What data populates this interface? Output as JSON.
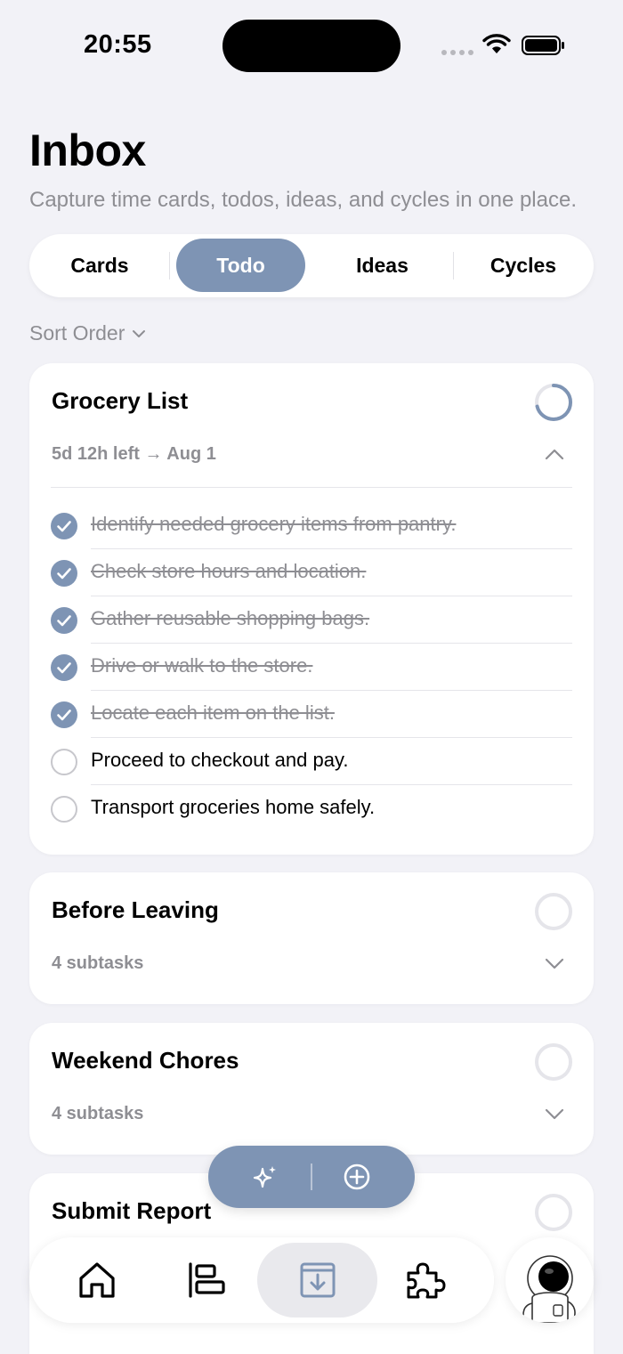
{
  "status": {
    "time": "20:55"
  },
  "header": {
    "title": "Inbox",
    "subtitle": "Capture time cards, todos, ideas, and cycles in one place."
  },
  "tabs": [
    {
      "label": "Cards"
    },
    {
      "label": "Todo",
      "active": true
    },
    {
      "label": "Ideas"
    },
    {
      "label": "Cycles"
    }
  ],
  "sort_label": "Sort Order",
  "accent_color": "#7e94b4",
  "cards": [
    {
      "title": "Grocery List",
      "meta": "5d 12h left → Aug 1",
      "progress": 0.71,
      "expanded": true,
      "items": [
        {
          "text": "Identify needed grocery items from pantry.",
          "done": true
        },
        {
          "text": "Check store hours and location.",
          "done": true
        },
        {
          "text": "Gather reusable shopping bags.",
          "done": true
        },
        {
          "text": "Drive or walk to the store.",
          "done": true
        },
        {
          "text": "Locate each item on the list.",
          "done": true
        },
        {
          "text": "Proceed to checkout and pay.",
          "done": false
        },
        {
          "text": "Transport groceries home safely.",
          "done": false
        }
      ]
    },
    {
      "title": "Before Leaving",
      "meta": "4 subtasks",
      "progress": 0
    },
    {
      "title": "Weekend Chores",
      "meta": "4 subtasks",
      "progress": 0
    },
    {
      "title": "Submit Report",
      "meta": "",
      "progress": 0
    }
  ],
  "tabbar": {
    "items": [
      "home-icon",
      "timeline-icon",
      "inbox-icon",
      "puzzle-icon"
    ],
    "active": "inbox-icon"
  }
}
